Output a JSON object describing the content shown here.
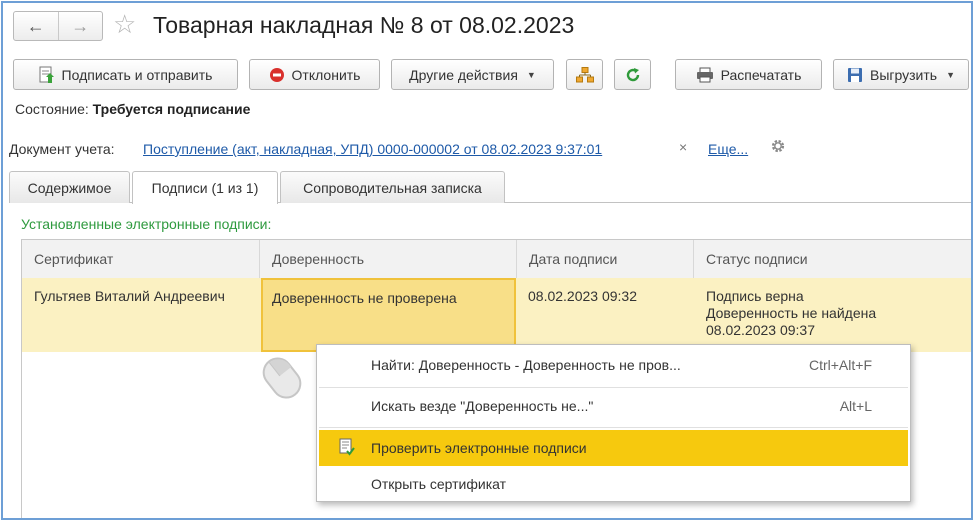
{
  "window": {
    "title": "Товарная накладная № 8 от 08.02.2023",
    "back_icon": "←",
    "forward_icon": "→",
    "star_icon": "☆"
  },
  "toolbar": {
    "sign_send": "Подписать и отправить",
    "reject": "Отклонить",
    "other_actions": "Другие действия",
    "print": "Распечатать",
    "export": "Выгрузить"
  },
  "status": {
    "label": "Состояние:",
    "value": "Требуется подписание"
  },
  "document": {
    "label": "Документ учета:",
    "link": "Поступление (акт, накладная, УПД) 0000-000002 от 08.02.2023 9:37:01",
    "clear": "×",
    "more": "Еще..."
  },
  "tabs": [
    {
      "label": "Содержимое"
    },
    {
      "label": "Подписи (1 из 1)"
    },
    {
      "label": "Сопроводительная записка"
    }
  ],
  "signatures": {
    "title": "Установленные электронные подписи:",
    "columns": [
      "Сертификат",
      "Доверенность",
      "Дата подписи",
      "Статус подписи"
    ],
    "rows": [
      {
        "certificate": "Гультяев Виталий Андреевич",
        "power_of_attorney": "Доверенность не проверена",
        "date": "08.02.2023 09:32",
        "status_line1": "Подпись верна",
        "status_line2": "Доверенность не найдена",
        "status_line3": "08.02.2023 09:37"
      }
    ]
  },
  "context_menu": {
    "items": [
      {
        "label": "Найти: Доверенность - Доверенность не пров...",
        "shortcut": "Ctrl+Alt+F"
      },
      {
        "label": "Искать везде \"Доверенность не...\"",
        "shortcut": "Alt+L"
      },
      {
        "label": "Проверить электронные подписи",
        "shortcut": ""
      },
      {
        "label": "Открыть сертификат",
        "shortcut": ""
      }
    ]
  },
  "colors": {
    "frame": "#6d9fd6",
    "link": "#1e5aa8",
    "section_title": "#2e9a3e",
    "row_highlight": "#fbf1c2",
    "selected_cell": "#f8df88",
    "menu_highlight": "#f6c90e"
  }
}
